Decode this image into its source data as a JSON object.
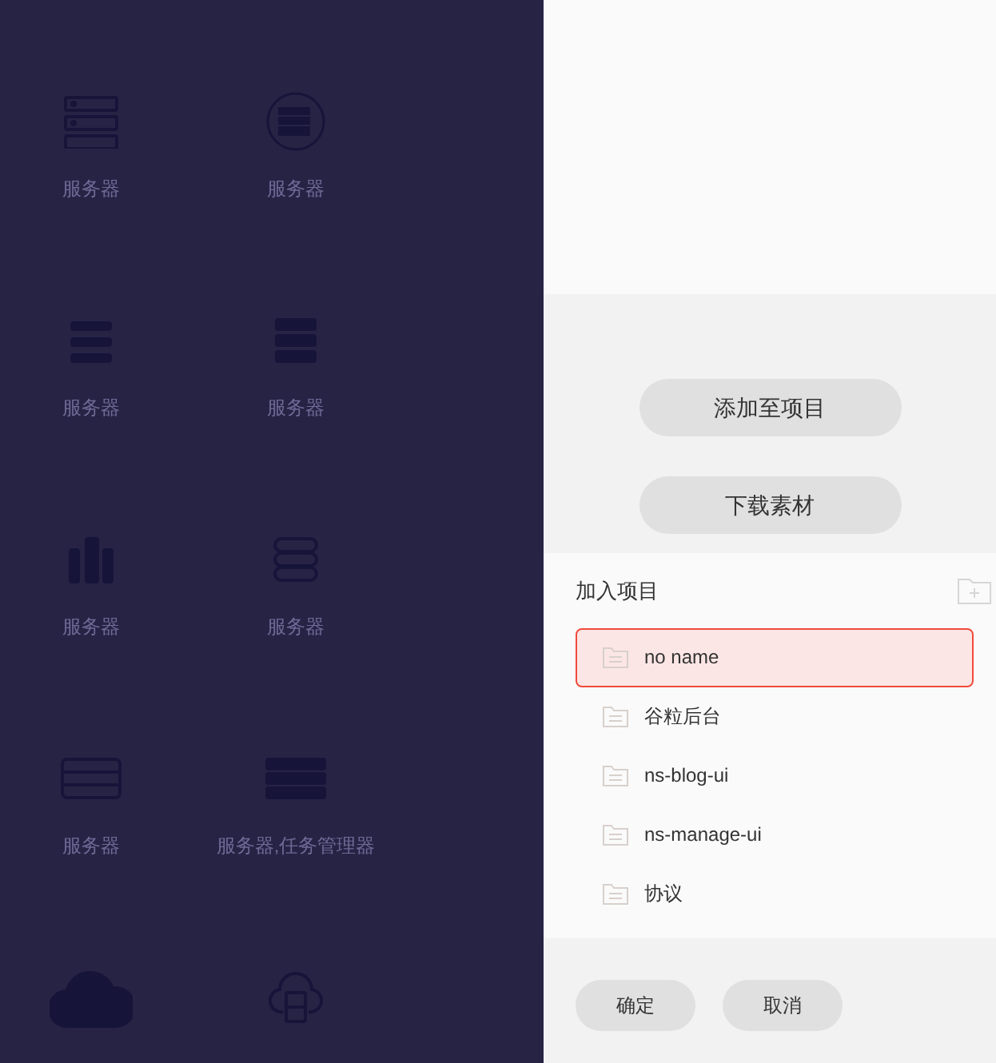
{
  "icon_grid": [
    {
      "kind": "rack-outline",
      "label": "服务器"
    },
    {
      "kind": "round-server",
      "label": "服务器"
    },
    {
      "kind": "rack-lines",
      "label": "服务器"
    },
    {
      "kind": "rack-solid",
      "label": "服务器"
    },
    {
      "kind": "towers",
      "label": "服务器"
    },
    {
      "kind": "stack-rounded",
      "label": "服务器"
    },
    {
      "kind": "rack-dots",
      "label": "服务器"
    },
    {
      "kind": "rack-bars",
      "label": "服务器,任务管理器"
    },
    {
      "kind": "cloud-solid"
    },
    {
      "kind": "cloud-outline"
    }
  ],
  "actions": [
    "添加至项目",
    "下载素材"
  ],
  "project_panel": {
    "title": "加入项目",
    "projects": [
      {
        "name": "no name",
        "selected": true
      },
      {
        "name": "谷粒后台",
        "selected": false
      },
      {
        "name": "ns-blog-ui",
        "selected": false
      },
      {
        "name": "ns-manage-ui",
        "selected": false
      },
      {
        "name": "协议",
        "selected": false
      }
    ]
  },
  "footer_buttons": [
    "确定",
    "取消"
  ]
}
